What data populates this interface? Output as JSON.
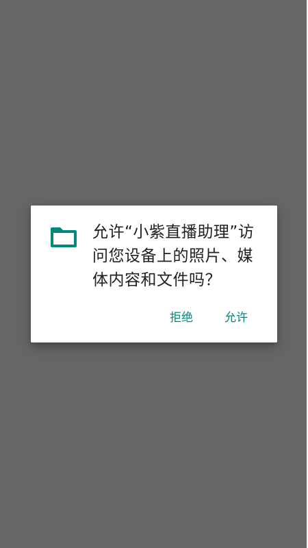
{
  "dialog": {
    "icon": "folder-icon",
    "message": "允许“小紫直播助理”访问您设备上的照片、媒体内容和文件吗？",
    "deny_label": "拒绝",
    "allow_label": "允许"
  },
  "colors": {
    "scrim": "#666666",
    "accent": "#00897b",
    "text": "#212121",
    "dialog_background": "#ffffff"
  }
}
